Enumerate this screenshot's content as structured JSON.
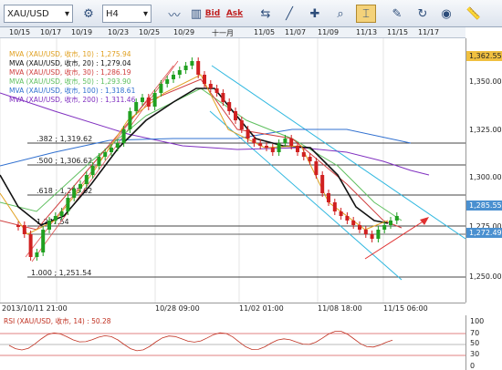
{
  "toolbar": {
    "symbol": "XAU/USD",
    "timeframe": "H4",
    "bid_label": "Bid",
    "ask_label": "Ask"
  },
  "top_axis_labels": [
    "10/15",
    "10/17",
    "10/19",
    "10/23",
    "10/25",
    "10/29",
    "十一月",
    "11/05",
    "11/07",
    "11/09",
    "11/13",
    "11/15",
    "11/17"
  ],
  "legend": [
    {
      "text": "MVA (XAU/USD, 收市, 10) : 1,275.94",
      "color": "#e0a020"
    },
    {
      "text": "MVA (XAU/USD, 收市, 20) : 1,279.04",
      "color": "#111111"
    },
    {
      "text": "MVA (XAU/USD, 收市, 30) : 1,286.19",
      "color": "#d04040"
    },
    {
      "text": "MVA (XAU/USD, 收市, 50) : 1,293.90",
      "color": "#60c060"
    },
    {
      "text": "MVA (XAU/USD, 收市, 100) : 1,318.61",
      "color": "#3070d0"
    },
    {
      "text": "MVA (XAU/USD, 收市, 200) : 1,311.46",
      "color": "#8030c0"
    }
  ],
  "fib_labels": [
    {
      "text": ".382 ; 1,319.62"
    },
    {
      "text": ".500 ; 1,306.62"
    },
    {
      "text": ".618 ; 1,293.62"
    },
    {
      "text": "1,277.54"
    },
    {
      "text": "1.000 ; 1,251.54"
    }
  ],
  "price_ticks": [
    "1,362.55",
    "1,350.00",
    "1,325.00",
    "1,300.00",
    "1,285.55",
    "1,275.00",
    "1,272.49",
    "1,250.00"
  ],
  "bottom_axis_labels": [
    "2013/10/11 21:00",
    "10/28 09:00",
    "11/02 01:00",
    "11/08 18:00",
    "11/15 06:00"
  ],
  "rsi": {
    "label": "RSI (XAU/USD, 收市, 14) : 50.28",
    "ticks": [
      "100",
      "70",
      "50",
      "30",
      "0"
    ]
  },
  "colors": {
    "up": "#20a020",
    "down": "#d02020",
    "channel": "#30b8e0",
    "arrow": "#e03030"
  }
}
